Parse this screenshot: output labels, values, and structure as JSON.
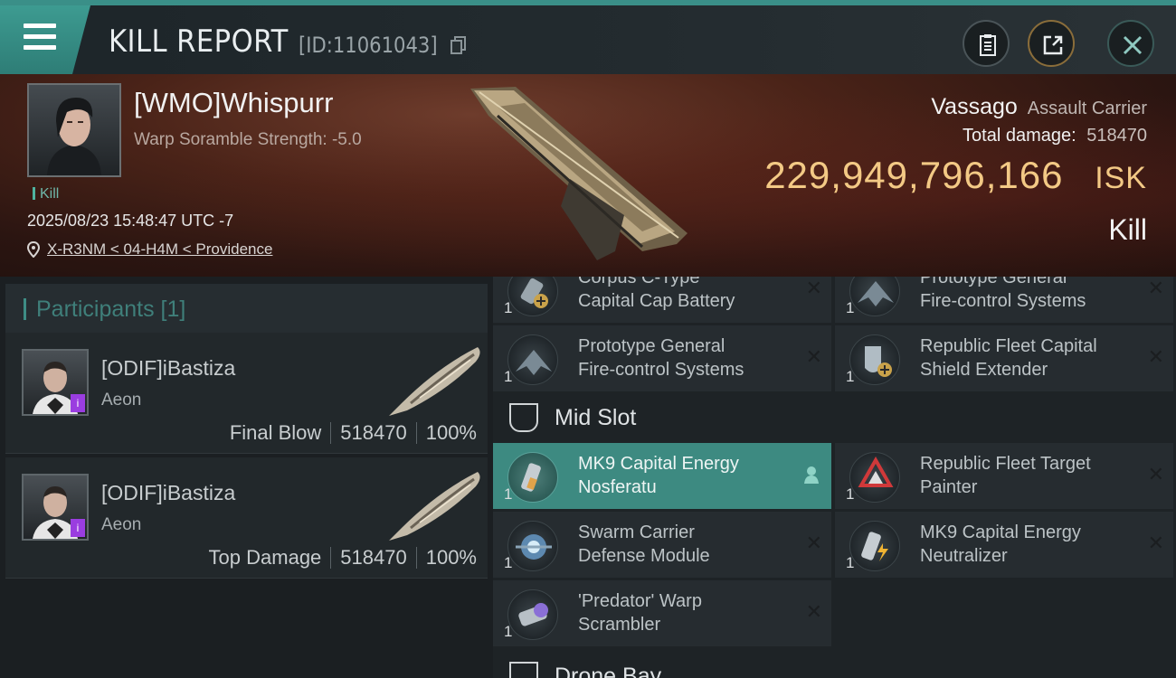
{
  "header": {
    "title": "KILL REPORT",
    "report_id": "[ID:11061043]",
    "icons": [
      "menu-icon",
      "copy-icon",
      "clipboard-icon",
      "share-icon",
      "close-icon"
    ]
  },
  "victim": {
    "name": "[WMO]Whispurr",
    "warp_scramble": "Warp Soramble Strength: -5.0",
    "tag": "Kill",
    "timestamp": "2025/08/23 15:48:47 UTC -7",
    "location": "X-R3NM < 04-H4M < Providence",
    "ship_name": "Vassago",
    "ship_class": "Assault Carrier",
    "total_damage_label": "Total damage:",
    "total_damage": "518470",
    "isk_value": "229,949,796,166",
    "isk_unit": "ISK",
    "result": "Kill"
  },
  "participants": {
    "title": "Participants [1]",
    "items": [
      {
        "name": "[ODIF]iBastiza",
        "ship": "Aeon",
        "role": "Final Blow",
        "damage": "518470",
        "percent": "100%",
        "badge": "i"
      },
      {
        "name": "[ODIF]iBastiza",
        "ship": "Aeon",
        "role": "Top Damage",
        "damage": "518470",
        "percent": "100%",
        "badge": "i"
      }
    ]
  },
  "fitting": {
    "top_modules": [
      {
        "name": "Corpus C-Type\nCapital Cap Battery",
        "qty": "1",
        "status": "destroyed"
      },
      {
        "name": "Prototype General\nFire-control Systems",
        "qty": "1",
        "status": "destroyed"
      },
      {
        "name": "Prototype General\nFire-control Systems",
        "qty": "1",
        "status": "destroyed"
      },
      {
        "name": "Republic Fleet Capital\nShield Extender",
        "qty": "1",
        "status": "destroyed"
      }
    ],
    "mid_slot_title": "Mid Slot",
    "mid_modules": [
      {
        "name": "MK9 Capital Energy\nNosferatu",
        "qty": "1",
        "status": "dropped"
      },
      {
        "name": "Republic Fleet Target\nPainter",
        "qty": "1",
        "status": "destroyed"
      },
      {
        "name": "Swarm Carrier\nDefense Module",
        "qty": "1",
        "status": "destroyed"
      },
      {
        "name": "MK9 Capital Energy\nNeutralizer",
        "qty": "1",
        "status": "destroyed"
      },
      {
        "name": "'Predator' Warp\nScrambler",
        "qty": "1",
        "status": "destroyed"
      }
    ],
    "drone_bay_title": "Drone Bay",
    "x_mark": "✕"
  },
  "colors": {
    "accent_teal": "#3d8a81",
    "isk_gold": "#f3c985",
    "badge_purple": "#9a3de0"
  }
}
